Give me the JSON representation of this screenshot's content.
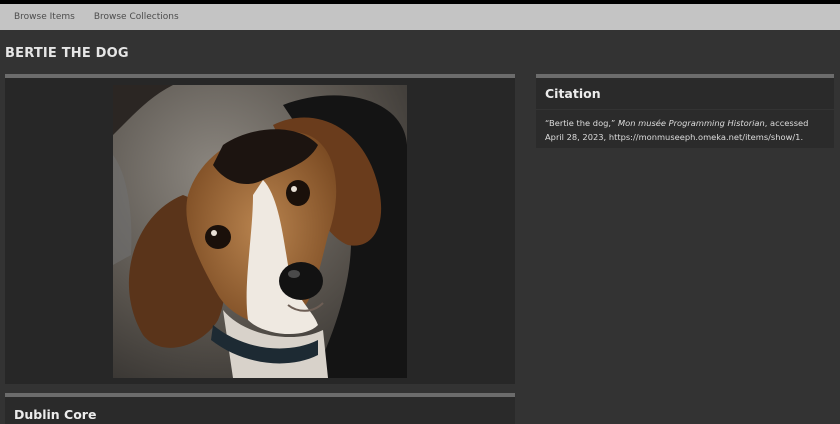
{
  "nav": {
    "items": [
      {
        "label": "Browse Items"
      },
      {
        "label": "Browse Collections"
      }
    ]
  },
  "item": {
    "title": "BERTIE THE DOG",
    "image_alt": "Photo of a beagle dog looking up"
  },
  "citation": {
    "heading": "Citation",
    "prefix": "“Bertie the dog,” ",
    "site_name": "Mon musée Programming Historian",
    "suffix": ", accessed April 28, 2023, https://monmuseeph.omeka.net/items/show/1."
  },
  "dublin_core": {
    "heading": "Dublin Core"
  },
  "colors": {
    "nav_bg": "#c4c4c4",
    "page_bg": "#333333",
    "panel_bg": "#272727",
    "panel_cap": "#6c6c6c"
  }
}
